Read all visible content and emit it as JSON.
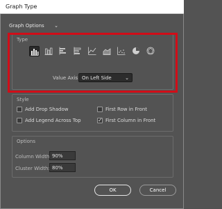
{
  "window": {
    "title": "Graph Type"
  },
  "options_dropdown": {
    "value": "Graph Options"
  },
  "type_section": {
    "title": "Type",
    "graph_icons": [
      "grouped-column-icon",
      "stacked-column-icon",
      "grouped-bar-icon",
      "stacked-bar-icon",
      "line-graph-icon",
      "area-graph-icon",
      "scatter-graph-icon",
      "pie-graph-icon",
      "radar-graph-icon"
    ],
    "selected_index": 0,
    "value_axis_label": "Value Axis:",
    "value_axis_value": "On Left Side"
  },
  "style_section": {
    "title": "Style",
    "add_drop_shadow": {
      "label": "Add Drop Shadow",
      "checked": false
    },
    "add_legend": {
      "label": "Add Legend Across Top",
      "checked": false
    },
    "first_row_front": {
      "label": "First Row in Front",
      "checked": false
    },
    "first_column_front": {
      "label": "First Column in Front",
      "checked": true
    }
  },
  "options_section": {
    "title": "Options",
    "column_width_label": "Column Width:",
    "column_width_value": "90%",
    "cluster_width_label": "Cluster Width:",
    "cluster_width_value": "80%"
  },
  "buttons": {
    "ok": "OK",
    "cancel": "Cancel"
  },
  "colors": {
    "highlight": "#d10d18",
    "dialog_bg": "#535353"
  }
}
